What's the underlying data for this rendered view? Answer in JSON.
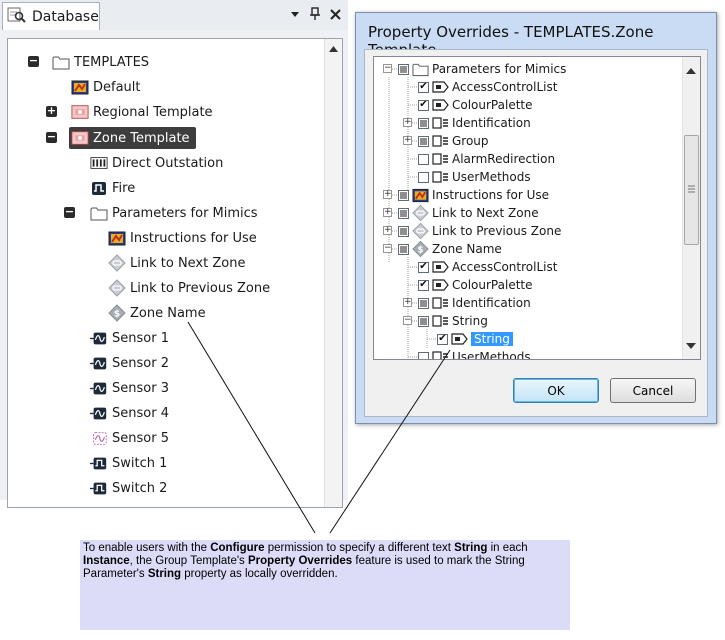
{
  "database_panel": {
    "tab_label": "Database",
    "tree": [
      {
        "label": "TEMPLATES",
        "icon": "folder-icon",
        "expander": "minus"
      },
      {
        "label": "Default",
        "icon": "mimic-icon"
      },
      {
        "label": "Regional Template",
        "icon": "template-icon",
        "expander": "plus"
      },
      {
        "label": "Zone Template",
        "icon": "template-icon",
        "expander": "minus",
        "selected": true
      },
      {
        "label": "Direct Outstation",
        "icon": "outstation-icon"
      },
      {
        "label": "Fire",
        "icon": "pulse-icon"
      },
      {
        "label": "Parameters for Mimics",
        "icon": "folder-icon",
        "expander": "minus"
      },
      {
        "label": "Instructions for Use",
        "icon": "mimic-icon"
      },
      {
        "label": "Link to Next Zone",
        "icon": "link-diamond-icon"
      },
      {
        "label": "Link to Previous Zone",
        "icon": "link-diamond-icon"
      },
      {
        "label": "Zone Name",
        "icon": "string-diamond-icon"
      },
      {
        "label": "Sensor 1",
        "icon": "sensor-icon"
      },
      {
        "label": "Sensor 2",
        "icon": "sensor-icon"
      },
      {
        "label": "Sensor 3",
        "icon": "sensor-icon"
      },
      {
        "label": "Sensor 4",
        "icon": "sensor-icon"
      },
      {
        "label": "Sensor 5",
        "icon": "sensor-disabled-icon"
      },
      {
        "label": "Switch 1",
        "icon": "switch-icon"
      },
      {
        "label": "Switch 2",
        "icon": "switch-icon"
      }
    ]
  },
  "dialog": {
    "title": "Property Overrides - TEMPLATES.Zone Template",
    "tree": [
      {
        "label": "Parameters for Mimics",
        "check": "tri",
        "icon": "folder-icon",
        "expander": "minus"
      },
      {
        "label": "AccessControlList",
        "check": "checked",
        "icon": "property-string-icon"
      },
      {
        "label": "ColourPalette",
        "check": "checked",
        "icon": "property-string-icon"
      },
      {
        "label": "Identification",
        "check": "tri",
        "icon": "property-group-icon",
        "expander": "plus"
      },
      {
        "label": "Group",
        "check": "tri",
        "icon": "property-group-icon",
        "expander": "plus"
      },
      {
        "label": "AlarmRedirection",
        "check": "unchecked",
        "icon": "property-group-icon"
      },
      {
        "label": "UserMethods",
        "check": "unchecked",
        "icon": "property-group-icon"
      },
      {
        "label": "Instructions for Use",
        "check": "tri",
        "icon": "mimic-icon",
        "expander": "plus"
      },
      {
        "label": "Link to Next Zone",
        "check": "tri",
        "icon": "link-diamond-icon",
        "expander": "plus"
      },
      {
        "label": "Link to Previous Zone",
        "check": "tri",
        "icon": "link-diamond-icon",
        "expander": "plus"
      },
      {
        "label": "Zone Name",
        "check": "tri",
        "icon": "string-diamond-icon",
        "expander": "minus"
      },
      {
        "label": "AccessControlList",
        "check": "checked",
        "icon": "property-string-icon"
      },
      {
        "label": "ColourPalette",
        "check": "checked",
        "icon": "property-string-icon"
      },
      {
        "label": "Identification",
        "check": "tri",
        "icon": "property-group-icon",
        "expander": "plus"
      },
      {
        "label": "String",
        "check": "tri",
        "icon": "property-group-icon",
        "expander": "minus"
      },
      {
        "label": "String",
        "check": "checked",
        "icon": "property-string-icon",
        "selected": true
      },
      {
        "label": "UserMethods",
        "check": "unchecked",
        "icon": "property-group-icon"
      }
    ],
    "ok_label": "OK",
    "cancel_label": "Cancel"
  },
  "callout": {
    "t1": "To enable users with the ",
    "b1": "Configure",
    "t2": " permission to specify a different text ",
    "b2": "String",
    "t3": " in each ",
    "b3": "Instance",
    "t4": ", the Group Template's ",
    "b4": "Property Overrides",
    "t5": " feature is used to mark the String Parameter's ",
    "b5": "String",
    "t6": " property as locally overridden."
  },
  "colors": {
    "dialog_frame": "#c9dcf3",
    "selection_dark": "#3d3d3d",
    "selection_blue": "#3399ff",
    "callout_bg": "#dcdcf8"
  }
}
